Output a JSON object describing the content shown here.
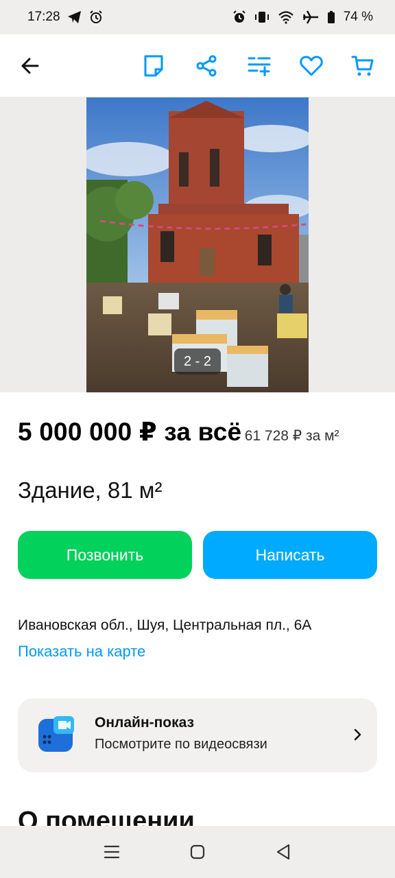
{
  "status_bar": {
    "time": "17:28",
    "battery": "74 %",
    "icons": [
      "telegram-icon",
      "alarm-icon",
      "vibrate-icon",
      "wifi-icon",
      "airplane-icon",
      "battery-icon"
    ]
  },
  "app_bar": {
    "icons": [
      "back-arrow-icon",
      "note-icon",
      "share-icon",
      "compare-list-icon",
      "favorite-heart-icon",
      "cart-icon"
    ],
    "accent_color": "#0099f7"
  },
  "gallery": {
    "counter": "2 - 2"
  },
  "listing": {
    "price": "5 000 000 ₽ за всё",
    "price_per_sqm": "61 728 ₽ за м²",
    "title": "Здание, 81 м²"
  },
  "actions": {
    "call_label": "Позвонить",
    "call_color": "#02d15c",
    "write_label": "Написать",
    "write_color": "#00aaff"
  },
  "location": {
    "address": "Ивановская обл., Шуя, Центральная пл., 6А",
    "map_link": "Показать на карте"
  },
  "online_tour": {
    "title": "Онлайн-показ",
    "subtitle": "Посмотрите по видеосвязи"
  },
  "section": {
    "heading": "О помещении"
  },
  "nav_bar": {
    "icons": [
      "menu-icon",
      "home-icon",
      "back-icon"
    ]
  }
}
